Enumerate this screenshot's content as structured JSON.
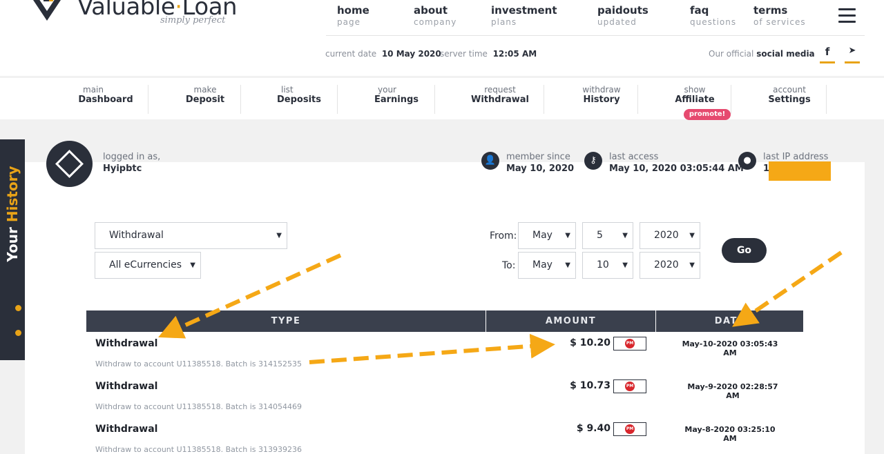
{
  "brand": {
    "name_part1": "Valuable",
    "name_part2": "Loan",
    "tagline": "simply perfect"
  },
  "top_nav": [
    {
      "title": "home",
      "sub": "page"
    },
    {
      "title": "about",
      "sub": "company"
    },
    {
      "title": "investment",
      "sub": "plans"
    },
    {
      "title": "paidouts",
      "sub": "updated"
    },
    {
      "title": "faq",
      "sub": "questions"
    },
    {
      "title": "terms",
      "sub": "of services"
    }
  ],
  "info": {
    "date_label": "current date",
    "date_value": "10 May 2020",
    "time_label": "server time",
    "time_value": "12:05 AM",
    "social_prefix": "Our official",
    "social_bold": "social media",
    "facebook_icon": "f",
    "telegram_icon": "➤"
  },
  "account_nav": [
    {
      "sub": "main",
      "title": "Dashboard"
    },
    {
      "sub": "make",
      "title": "Deposit"
    },
    {
      "sub": "list",
      "title": "Deposits"
    },
    {
      "sub": "your",
      "title": "Earnings"
    },
    {
      "sub": "request",
      "title": "Withdrawal"
    },
    {
      "sub": "withdraw",
      "title": "History"
    },
    {
      "sub": "show",
      "title": "Affiliate"
    },
    {
      "sub": "account",
      "title": "Settings"
    }
  ],
  "promote_badge": "promote!",
  "side_tab": {
    "part1": "Your",
    "part2": "History"
  },
  "user": {
    "logged_label": "logged in as,",
    "username": "Hyipbtc",
    "member_label": "member since",
    "member_value": "May 10, 2020",
    "access_label": "last access",
    "access_value": "May 10, 2020 03:05:44 AM",
    "ip_label": "last IP address",
    "ip_value": "1"
  },
  "filters": {
    "type": "Withdrawal",
    "currency": "All eCurrencies",
    "from_label": "From:",
    "to_label": "To:",
    "from_month": "May",
    "from_day": "5",
    "from_year": "2020",
    "to_month": "May",
    "to_day": "10",
    "to_year": "2020",
    "go": "Go"
  },
  "table": {
    "headers": [
      "TYPE",
      "AMOUNT",
      "DATE"
    ],
    "rows": [
      {
        "type": "Withdrawal",
        "desc": "Withdraw to account U11385518. Batch is 314152535",
        "amount": "$ 10.20",
        "badge": "PM",
        "date": "May-10-2020 03:05:43 AM"
      },
      {
        "type": "Withdrawal",
        "desc": "Withdraw to account U11385518. Batch is 314054469",
        "amount": "$ 10.73",
        "badge": "PM",
        "date": "May-9-2020 02:28:57 AM"
      },
      {
        "type": "Withdrawal",
        "desc": "Withdraw to account U11385518. Batch is 313939236",
        "amount": "$ 9.40",
        "badge": "PM",
        "date": "May-8-2020 03:25:10 AM"
      }
    ]
  },
  "colors": {
    "accent": "#e8a317",
    "dark": "#2a2f3a",
    "promote": "#e64a6f",
    "pm_red": "#d8262c"
  }
}
